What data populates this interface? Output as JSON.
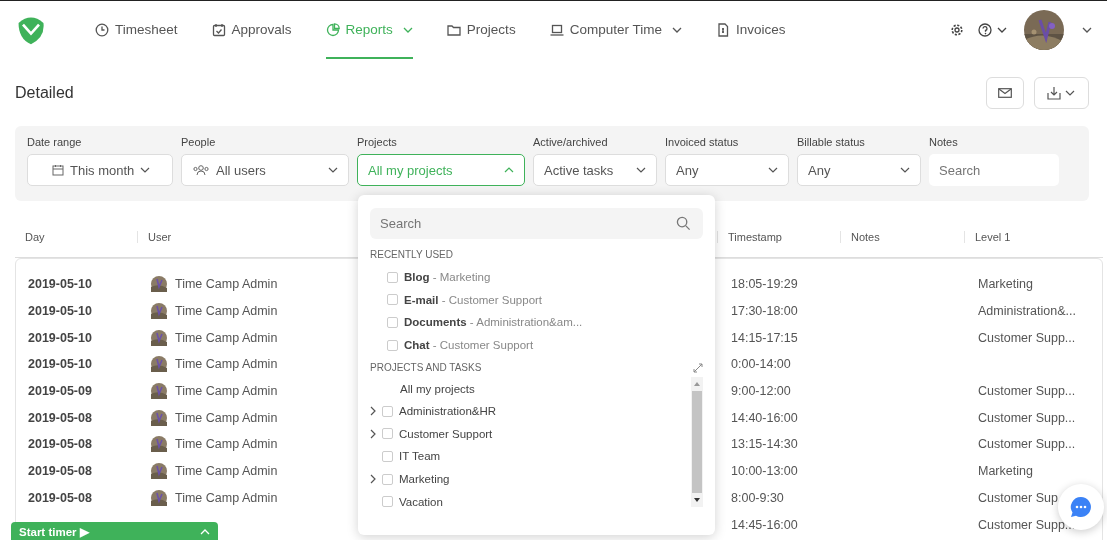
{
  "nav": [
    {
      "label": "Timesheet",
      "selected": false,
      "dropdown": false
    },
    {
      "label": "Approvals",
      "selected": false,
      "dropdown": false
    },
    {
      "label": "Reports",
      "selected": true,
      "dropdown": true
    },
    {
      "label": "Projects",
      "selected": false,
      "dropdown": false
    },
    {
      "label": "Computer Time",
      "selected": false,
      "dropdown": true
    },
    {
      "label": "Invoices",
      "selected": false,
      "dropdown": false
    }
  ],
  "page_title": "Detailed",
  "filters": [
    {
      "label": "Date range",
      "kind": "select",
      "value": "This month",
      "open": false
    },
    {
      "label": "People",
      "kind": "select",
      "value": "All users",
      "open": false
    },
    {
      "label": "Projects",
      "kind": "select",
      "value": "All my projects",
      "open": true
    },
    {
      "label": "Active/archived",
      "kind": "select",
      "value": "Active tasks",
      "open": false
    },
    {
      "label": "Invoiced status",
      "kind": "select",
      "value": "Any",
      "open": false
    },
    {
      "label": "Billable status",
      "kind": "select",
      "value": "Any",
      "open": false
    },
    {
      "label": "Notes",
      "kind": "input",
      "placeholder": "Search"
    }
  ],
  "table": {
    "columns": [
      "Day",
      "User",
      "Timestamp",
      "Notes",
      "Level 1"
    ],
    "rows": [
      {
        "day": "2019-05-10",
        "user": "Time Camp Admin",
        "timestamp": "18:05-19:29",
        "level_1": "Marketing"
      },
      {
        "day": "2019-05-10",
        "user": "Time Camp Admin",
        "timestamp": "17:30-18:00",
        "level_1": "Administration&..."
      },
      {
        "day": "2019-05-10",
        "user": "Time Camp Admin",
        "timestamp": "14:15-17:15",
        "level_1": "Customer Supp..."
      },
      {
        "day": "2019-05-10",
        "user": "Time Camp Admin",
        "timestamp": "0:00-14:00"
      },
      {
        "day": "2019-05-09",
        "user": "Time Camp Admin",
        "timestamp": "9:00-12:00",
        "level_1": "Customer Supp..."
      },
      {
        "day": "2019-05-08",
        "user": "Time Camp Admin",
        "timestamp": "14:40-16:00",
        "level_1": "Customer Supp..."
      },
      {
        "day": "2019-05-08",
        "user": "Time Camp Admin",
        "timestamp": "13:15-14:30",
        "level_1": "Customer Supp..."
      },
      {
        "day": "2019-05-08",
        "user": "Time Camp Admin",
        "timestamp": "10:00-13:00",
        "level_1": "Marketing"
      },
      {
        "day": "2019-05-08",
        "user": "Time Camp Admin",
        "timestamp": "8:00-9:30",
        "level_1": "Customer Sup"
      },
      {
        "timestamp": "14:45-16:00",
        "level_1": "Customer Supp..."
      }
    ]
  },
  "projects_dropdown": {
    "search_placeholder": "Search",
    "recent_heading": "RECENTLY USED",
    "recent": [
      {
        "label": "**Blog** - Marketing",
        "checked": false
      },
      {
        "label": "**E-mail** - Customer Support",
        "checked": false
      },
      {
        "label": "**Documents** - Administration&am...",
        "checked": false
      },
      {
        "label": "**Chat** - Customer Support",
        "checked": false
      }
    ],
    "tree_heading": "PROJECTS AND TASKS",
    "all_label": "All my projects",
    "tree": [
      {
        "name": "Administration&HR",
        "expandable": true,
        "checked": false
      },
      {
        "name": "Customer Support",
        "expandable": true,
        "checked": false
      },
      {
        "name": "IT Team",
        "expandable": false,
        "checked": false
      },
      {
        "name": "Marketing",
        "expandable": true,
        "checked": false
      },
      {
        "name": "Vacation",
        "expandable": false,
        "checked": false
      }
    ]
  },
  "start_timer": {
    "label": "Start timer ▶"
  }
}
